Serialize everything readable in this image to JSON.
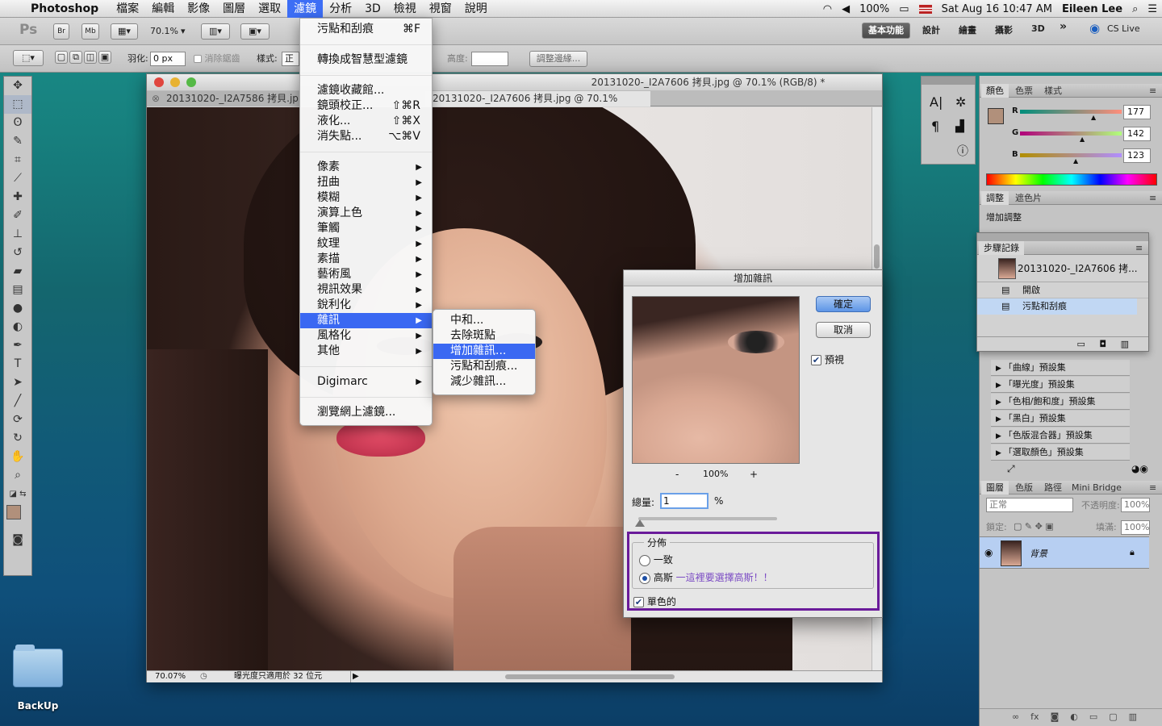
{
  "menubar": {
    "app_name": "Photoshop",
    "items": [
      "檔案",
      "編輯",
      "影像",
      "圖層",
      "選取",
      "濾鏡",
      "分析",
      "3D",
      "檢視",
      "視窗",
      "說明"
    ],
    "active_index": 5,
    "battery": "100%",
    "datetime": "Sat Aug 16  10:47 AM",
    "user": "Eileen Lee"
  },
  "appbar": {
    "ps_label": "Ps",
    "br_label": "Br",
    "mb_label": "Mb",
    "zoom": "70.1%",
    "workspaces": [
      "基本功能",
      "設計",
      "繪畫",
      "攝影",
      "3D"
    ],
    "more": "»",
    "cs_live": "CS Live"
  },
  "optbar": {
    "feather_label": "羽化:",
    "feather_value": "0 px",
    "antialias_label": "消除鋸齒",
    "style_label": "樣式:",
    "style_value": "正",
    "height_label": "高度:",
    "refine_button": "調整邊緣..."
  },
  "document": {
    "title": "20131020-_I2A7606 拷貝.jpg @ 70.1% (RGB/8) *",
    "tabs": [
      {
        "label": "20131020-_I2A7586 拷貝.jp",
        "active": false
      },
      {
        "label": "20131020-_I2A7606 拷貝.jpg @ 70.1% (RGB/8) *",
        "active": true
      }
    ],
    "status_zoom": "70.07%",
    "status_text": "曝光度只適用於 32 位元"
  },
  "filter_menu": {
    "items": [
      {
        "label": "污點和刮痕",
        "shortcut": "⌘F"
      },
      {
        "sep": true
      },
      {
        "label": "轉換成智慧型濾鏡"
      },
      {
        "sep": true
      },
      {
        "label": "濾鏡收藏館..."
      },
      {
        "label": "鏡頭校正...",
        "shortcut": "⇧⌘R"
      },
      {
        "label": "液化...",
        "shortcut": "⇧⌘X"
      },
      {
        "label": "消失點...",
        "shortcut": "⌥⌘V"
      },
      {
        "sep": true
      },
      {
        "label": "像素",
        "submenu": true
      },
      {
        "label": "扭曲",
        "submenu": true
      },
      {
        "label": "模糊",
        "submenu": true
      },
      {
        "label": "演算上色",
        "submenu": true
      },
      {
        "label": "筆觸",
        "submenu": true
      },
      {
        "label": "紋理",
        "submenu": true
      },
      {
        "label": "素描",
        "submenu": true
      },
      {
        "label": "藝術風",
        "submenu": true
      },
      {
        "label": "視訊效果",
        "submenu": true
      },
      {
        "label": "銳利化",
        "submenu": true
      },
      {
        "label": "雜訊",
        "submenu": true,
        "highlighted": true
      },
      {
        "label": "風格化",
        "submenu": true
      },
      {
        "label": "其他",
        "submenu": true
      },
      {
        "sep": true
      },
      {
        "label": "Digimarc",
        "submenu": true
      },
      {
        "sep": true
      },
      {
        "label": "瀏覽網上濾鏡..."
      }
    ]
  },
  "noise_submenu": {
    "items": [
      {
        "label": "中和..."
      },
      {
        "label": "去除斑點"
      },
      {
        "label": "增加雜訊...",
        "highlighted": true
      },
      {
        "label": "污點和刮痕..."
      },
      {
        "label": "減少雜訊..."
      }
    ]
  },
  "dialog": {
    "title": "增加雜訊",
    "ok": "確定",
    "cancel": "取消",
    "preview_label": "預視",
    "preview_checked": true,
    "zoom_minus": "-",
    "zoom_value": "100%",
    "zoom_plus": "+",
    "amount_label": "總量:",
    "amount_value": "1",
    "amount_unit": "%",
    "amount_fraction": 0.01,
    "distribution_label": "分佈",
    "uniform_label": "一致",
    "gaussian_label": "高斯",
    "gaussian_note": "一這裡要選擇高斯！！",
    "distribution_selected": "gaussian",
    "mono_label": "單色的",
    "mono_checked": true,
    "highlight_color": "#6a1b9a"
  },
  "color_panel": {
    "tabs": [
      "顏色",
      "色票",
      "樣式"
    ],
    "fg_color": "#b1907b",
    "r_label": "R",
    "r_value": "177",
    "g_label": "G",
    "g_value": "142",
    "b_label": "B",
    "b_value": "123"
  },
  "adjust_panel": {
    "tabs": [
      "調整",
      "遮色片"
    ],
    "heading": "增加調整",
    "presets": [
      "「曲線」預設集",
      "「曝光度」預設集",
      "「色相/飽和度」預設集",
      "「黑白」預設集",
      "「色版混合器」預設集",
      "「選取顏色」預設集"
    ]
  },
  "history_panel": {
    "tab": "步驟記錄",
    "snapshot": "20131020-_I2A7606 拷...",
    "items": [
      "開啟",
      "污點和刮痕"
    ]
  },
  "layers_panel": {
    "tabs": [
      "圖層",
      "色版",
      "路徑",
      "Mini Bridge"
    ],
    "blend_mode": "正常",
    "opacity_label": "不透明度:",
    "opacity_value": "100%",
    "lock_label": "鎖定:",
    "fill_label": "填滿:",
    "fill_value": "100%",
    "layer_name": "背景"
  },
  "desktop": {
    "folder_label": "BackUp"
  }
}
